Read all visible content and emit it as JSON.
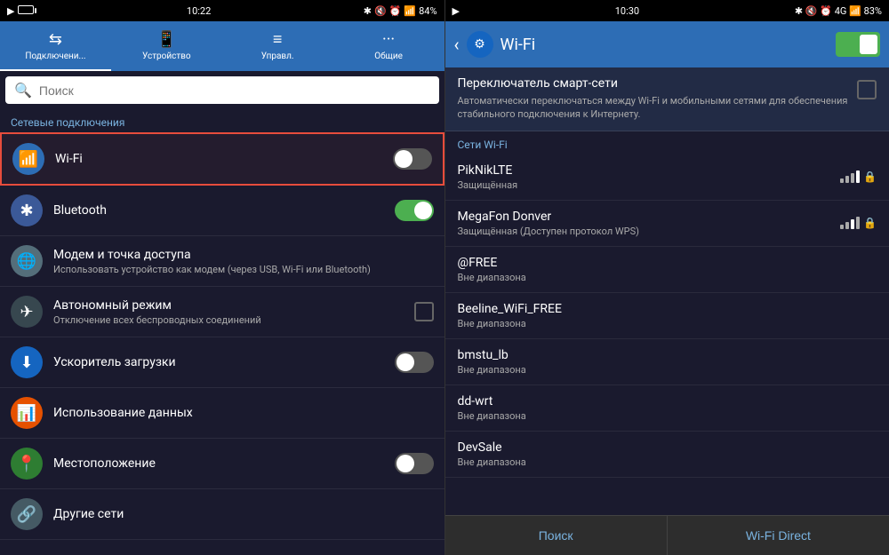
{
  "left": {
    "statusBar": {
      "time": "10:22",
      "battery": "84%"
    },
    "tabs": [
      {
        "id": "connections",
        "label": "Подключени...",
        "icon": "⇆",
        "active": true
      },
      {
        "id": "device",
        "label": "Устройство",
        "icon": "📱",
        "active": false
      },
      {
        "id": "manage",
        "label": "Управл.",
        "icon": "≡",
        "active": false
      },
      {
        "id": "general",
        "label": "Общие",
        "icon": "···",
        "active": false
      }
    ],
    "searchPlaceholder": "Поиск",
    "sectionLabel": "Сетевые подключения",
    "items": [
      {
        "id": "wifi",
        "title": "Wi-Fi",
        "subtitle": "",
        "icon": "wifi",
        "iconBg": "icon-wifi",
        "toggle": "off",
        "highlighted": true
      },
      {
        "id": "bluetooth",
        "title": "Bluetooth",
        "subtitle": "",
        "icon": "bt",
        "iconBg": "icon-bt",
        "toggle": "on",
        "highlighted": false
      },
      {
        "id": "modem",
        "title": "Модем и точка доступа",
        "subtitle": "Использовать устройство как модем (через USB, Wi-Fi или Bluetooth)",
        "icon": "modem",
        "iconBg": "icon-modem",
        "toggle": null,
        "highlighted": false
      },
      {
        "id": "airplane",
        "title": "Автономный режим",
        "subtitle": "Отключение всех беспроводных соединений",
        "icon": "plane",
        "iconBg": "icon-plane",
        "toggle": null,
        "checkbox": true,
        "highlighted": false
      },
      {
        "id": "downloader",
        "title": "Ускоритель загрузки",
        "subtitle": "",
        "icon": "speed",
        "iconBg": "icon-speed",
        "toggle": "off",
        "highlighted": false
      },
      {
        "id": "datausage",
        "title": "Использование данных",
        "subtitle": "",
        "icon": "data",
        "iconBg": "icon-data",
        "toggle": null,
        "highlighted": false
      },
      {
        "id": "location",
        "title": "Местоположение",
        "subtitle": "",
        "icon": "loc",
        "iconBg": "icon-loc",
        "toggle": "off",
        "highlighted": false
      },
      {
        "id": "other",
        "title": "Другие сети",
        "subtitle": "",
        "icon": "other",
        "iconBg": "icon-other",
        "toggle": null,
        "highlighted": false
      }
    ]
  },
  "right": {
    "statusBar": {
      "time": "10:30",
      "battery": "83%"
    },
    "header": {
      "title": "Wi-Fi",
      "backLabel": "‹",
      "settingsIcon": "⚙"
    },
    "smartSwitch": {
      "title": "Переключатель смарт-сети",
      "desc": "Автоматически переключаться между Wi-Fi и мобильными сетями для обеспечения стабильного подключения к Интернету."
    },
    "networksLabel": "Сети Wi-Fi",
    "networks": [
      {
        "name": "PikNikLTE",
        "status": "Защищённая",
        "signal": 4,
        "lock": true
      },
      {
        "name": "MegaFon Donver",
        "status": "Защищённая (Доступен протокол WPS)",
        "signal": 3,
        "lock": true
      },
      {
        "name": "@FREE",
        "status": "Вне диапазона",
        "signal": 0,
        "lock": false
      },
      {
        "name": "Beeline_WiFi_FREE",
        "status": "Вне диапазона",
        "signal": 0,
        "lock": false
      },
      {
        "name": "bmstu_lb",
        "status": "Вне диапазона",
        "signal": 0,
        "lock": false
      },
      {
        "name": "dd-wrt",
        "status": "Вне диапазона",
        "signal": 0,
        "lock": false
      },
      {
        "name": "DevSale",
        "status": "Вне диапазона",
        "signal": 0,
        "lock": false
      }
    ],
    "buttons": {
      "search": "Поиск",
      "wifiDirect": "Wi-Fi Direct"
    }
  }
}
